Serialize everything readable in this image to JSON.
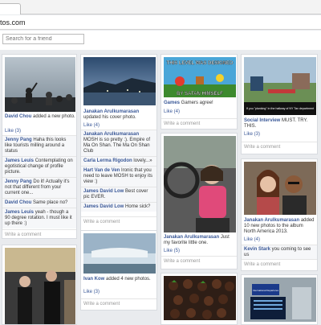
{
  "browser": {
    "url": "tos.com"
  },
  "search": {
    "placeholder": "Search for a friend"
  },
  "ui": {
    "write_comment": "Write a comment"
  },
  "cards": {
    "c1": {
      "author": "David Chou",
      "text": " added a new photo.",
      "like": "Like (3)",
      "comments": [
        {
          "author": "Jenny Pang",
          "text": " Haha this looks like tourists milling around a status"
        },
        {
          "author": "James Leuis",
          "text": " Contemplating on egotistical change of profile picture."
        },
        {
          "author": "Jenny Pang",
          "text": " Do it! Actually it's not that different from your current one..."
        },
        {
          "author": "David Chou",
          "text": " Same place no?"
        },
        {
          "author": "James Leuis",
          "text": " yeah - though a 90 degree rotation. I must like it up there :)"
        }
      ]
    },
    "c2": {
      "author": "Janakan Arulkumarasan",
      "text": " updated his cover photo.",
      "like": "Like (4)",
      "comments": [
        {
          "author": "Janakan Arulkumarasan",
          "text": " MOSH is so pretty :). Empire of Ma On Shan. The Ma On Shan Club"
        },
        {
          "author": "Carla Lerma Rigodon",
          "text": " lovely...»"
        },
        {
          "author": "Hart Van de Ven",
          "text": " Ironic that you need to leave MOSH to enjoy its view :)"
        },
        {
          "author": "James David Low",
          "text": " Best cover pic EVER."
        },
        {
          "author": "James David Low",
          "text": " Home sick?"
        }
      ]
    },
    "c3": {
      "meme_line1": "THIS LEVEL WAS DESIGNED",
      "meme_line2": "BY SATAN HIMSELF",
      "author": "Games",
      "text": " Gamers agree!",
      "like": "Like (4)"
    },
    "c4": {
      "sign_text": "If you \"planking\" in the hallway of NY Tax department",
      "author": "Social Interview",
      "text": " MUST. TRY. THIS.",
      "like": "Like (3)"
    },
    "c5": {
      "author": "Janakan Arulkumarasan",
      "text": " Just my favorite little one.",
      "like": "Like (5)"
    },
    "c6": {
      "author": "Janakan Arulkumarasan",
      "text": " added 10 new photos to the album North America 2013.",
      "like": "Like (4)",
      "comments": [
        {
          "author": "Kevin Stark",
          "text": " you coming to see us"
        }
      ]
    },
    "c7": {
      "author": "Ivan Kow",
      "text": " added 4 new photos.",
      "like": "Like (3)"
    },
    "c8": {
      "sign_text": "International Departures"
    }
  }
}
